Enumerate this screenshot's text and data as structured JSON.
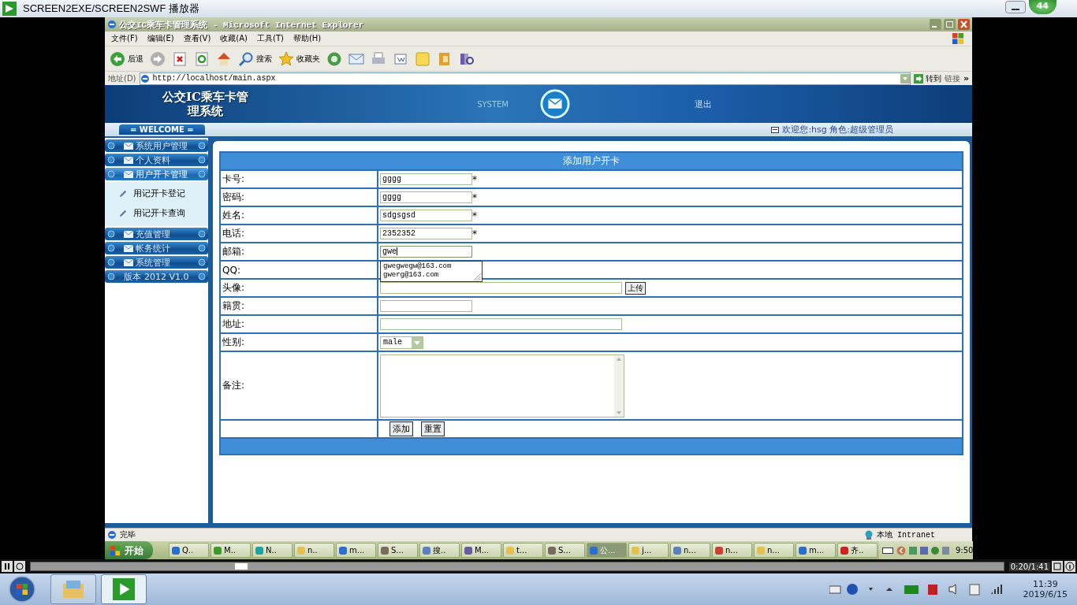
{
  "player": {
    "title": "SCREEN2EXE/SCREEN2SWF 播放器",
    "badge": "44",
    "time": "0:20/1:41",
    "progress": {
      "level": 0.21
    }
  },
  "browser": {
    "title": "公交IC乘车卡管理系统 - Microsoft Internet Explorer",
    "menu": [
      "文件(F)",
      "编辑(E)",
      "查看(V)",
      "收藏(A)",
      "工具(T)",
      "帮助(H)"
    ],
    "toolbar": [
      {
        "kind": "back",
        "label": "后退"
      },
      {
        "kind": "forward"
      },
      {
        "kind": "stop"
      },
      {
        "kind": "refresh"
      },
      {
        "kind": "home"
      },
      {
        "kind": "search",
        "label": "搜索"
      },
      {
        "kind": "favorites",
        "label": "收藏夹"
      },
      {
        "kind": "media"
      },
      {
        "kind": "mail"
      },
      {
        "kind": "print"
      },
      {
        "kind": "edit"
      },
      {
        "kind": "note"
      },
      {
        "kind": "folder"
      },
      {
        "kind": "research"
      }
    ],
    "address_label": "地址(D)",
    "url": "http://localhost/main.aspx",
    "go": "转到",
    "links": "链接",
    "links_more": "»",
    "status": "完毕",
    "zone": "本地 Intranet"
  },
  "site": {
    "title": "公交IC乘车卡管理系统",
    "system": "SYSTEM",
    "logout": "退出",
    "welcome": "= WELCOME =",
    "user_info": "欢迎您:hsg 角色:超级管理员",
    "sidebar": [
      {
        "label": "系统用户管理",
        "expanded": false
      },
      {
        "label": "个人资料",
        "expanded": false
      },
      {
        "label": "用户开卡管理",
        "expanded": true,
        "children": [
          {
            "label": "用记开卡登记"
          },
          {
            "label": "用记开卡查询"
          }
        ]
      },
      {
        "label": "充值管理",
        "expanded": false
      },
      {
        "label": "帐务统计",
        "expanded": false
      },
      {
        "label": "系统管理",
        "expanded": false
      }
    ],
    "version": "版本 2012 V1.0",
    "form": {
      "title": "添加用户开卡",
      "fields": [
        {
          "label": "卡号:",
          "kind": "text",
          "value": "gggg",
          "mark": "*"
        },
        {
          "label": "密码:",
          "kind": "text",
          "value": "gggg",
          "mark": "*"
        },
        {
          "label": "姓名:",
          "kind": "text",
          "value": "sdgsgsd",
          "mark": "*"
        },
        {
          "label": "电话:",
          "kind": "text",
          "value": "2352352",
          "mark": "*"
        },
        {
          "label": "邮箱:",
          "kind": "text",
          "value": "gwe",
          "focused": true,
          "suggestions": [
            "gwegwegw@163.com",
            "gwerg@163.com"
          ]
        },
        {
          "label": "QQ:",
          "kind": "covered"
        },
        {
          "label": "头像:",
          "kind": "file",
          "button": "上传"
        },
        {
          "label": "籍贯:",
          "kind": "text"
        },
        {
          "label": "地址:",
          "kind": "wide"
        },
        {
          "label": "性别:",
          "kind": "select",
          "value": "male"
        },
        {
          "label": "备注:",
          "kind": "textarea"
        }
      ],
      "buttons": [
        "添加",
        "重置"
      ]
    }
  },
  "xp_taskbar": {
    "start": "开始",
    "tasks": [
      {
        "label": "Q..",
        "selected": false
      },
      {
        "label": "M..",
        "selected": false
      },
      {
        "label": "N..",
        "selected": false
      },
      {
        "label": "n..",
        "selected": false
      },
      {
        "label": "m...",
        "selected": false
      },
      {
        "label": "S...",
        "selected": false
      },
      {
        "label": "搜..",
        "selected": false
      },
      {
        "label": "M...",
        "selected": false
      },
      {
        "label": "t...",
        "selected": false
      },
      {
        "label": "S...",
        "selected": false
      },
      {
        "label": "公...",
        "selected": true
      },
      {
        "label": "j...",
        "selected": false
      },
      {
        "label": "n...",
        "selected": false
      },
      {
        "label": "n...",
        "selected": false
      },
      {
        "label": "n...",
        "selected": false
      },
      {
        "label": "m...",
        "selected": false
      },
      {
        "label": "齐..",
        "selected": false
      }
    ],
    "clock": "9:50"
  },
  "win7_taskbar": {
    "pinned": [
      {
        "selected": false
      },
      {
        "selected": true
      }
    ],
    "time": "11:39",
    "date": "2019/6/15"
  }
}
